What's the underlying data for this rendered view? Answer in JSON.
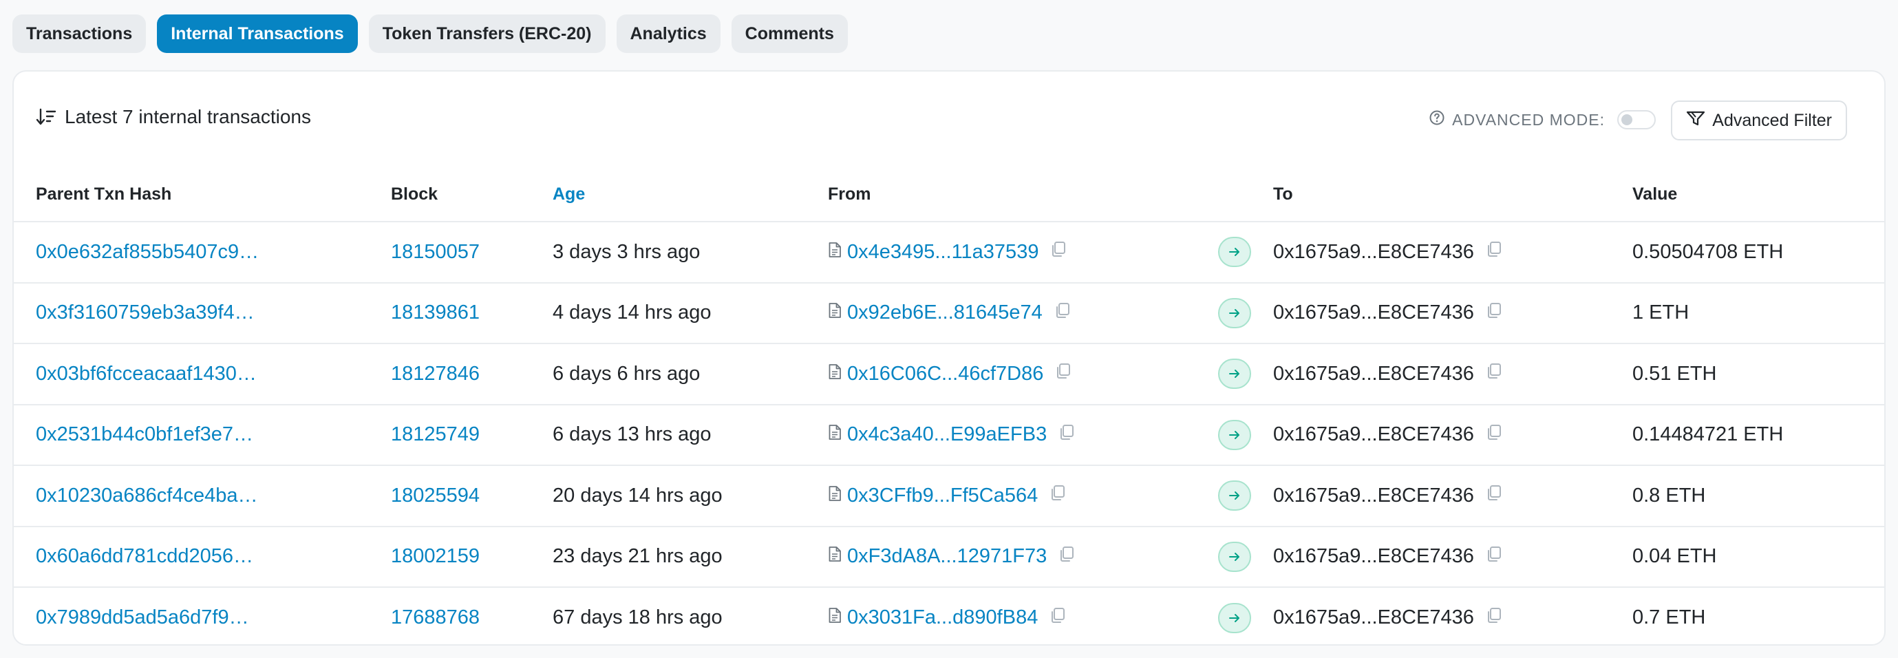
{
  "tabs": [
    {
      "label": "Transactions",
      "active": false
    },
    {
      "label": "Internal Transactions",
      "active": true
    },
    {
      "label": "Token Transfers (ERC-20)",
      "active": false
    },
    {
      "label": "Analytics",
      "active": false
    },
    {
      "label": "Comments",
      "active": false
    }
  ],
  "header": {
    "title": "Latest 7 internal transactions",
    "advanced_mode_label": "ADVANCED MODE:",
    "advanced_filter_label": "Advanced Filter"
  },
  "columns": {
    "hash": "Parent Txn Hash",
    "block": "Block",
    "age": "Age",
    "from": "From",
    "to": "To",
    "value": "Value"
  },
  "rows": [
    {
      "hash": "0x0e632af855b5407c9…",
      "block": "18150057",
      "age": "3 days 3 hrs ago",
      "from": "0x4e3495...11a37539",
      "to": "0x1675a9...E8CE7436",
      "value": "0.50504708 ETH"
    },
    {
      "hash": "0x3f3160759eb3a39f4…",
      "block": "18139861",
      "age": "4 days 14 hrs ago",
      "from": "0x92eb6E...81645e74",
      "to": "0x1675a9...E8CE7436",
      "value": "1 ETH"
    },
    {
      "hash": "0x03bf6fcceacaaf1430…",
      "block": "18127846",
      "age": "6 days 6 hrs ago",
      "from": "0x16C06C...46cf7D86",
      "to": "0x1675a9...E8CE7436",
      "value": "0.51 ETH"
    },
    {
      "hash": "0x2531b44c0bf1ef3e7…",
      "block": "18125749",
      "age": "6 days 13 hrs ago",
      "from": "0x4c3a40...E99aEFB3",
      "to": "0x1675a9...E8CE7436",
      "value": "0.14484721 ETH"
    },
    {
      "hash": "0x10230a686cf4ce4ba…",
      "block": "18025594",
      "age": "20 days 14 hrs ago",
      "from": "0x3CFfb9...Ff5Ca564",
      "to": "0x1675a9...E8CE7436",
      "value": "0.8 ETH"
    },
    {
      "hash": "0x60a6dd781cdd2056…",
      "block": "18002159",
      "age": "23 days 21 hrs ago",
      "from": "0xF3dA8A...12971F73",
      "to": "0x1675a9...E8CE7436",
      "value": "0.04 ETH"
    },
    {
      "hash": "0x7989dd5ad5a6d7f9…",
      "block": "17688768",
      "age": "67 days 18 hrs ago",
      "from": "0x3031Fa...d890fB84",
      "to": "0x1675a9...E8CE7436",
      "value": "0.7 ETH"
    }
  ],
  "colors": {
    "accent": "#0784c3",
    "arrow_bg": "#dff5ee",
    "arrow_fg": "#00a186"
  },
  "icons": {
    "sort": "sort-descending-icon",
    "help": "question-circle-icon",
    "filter": "filter-icon",
    "contract": "contract-document-icon",
    "copy": "copy-icon",
    "arrow": "arrow-right-icon"
  }
}
